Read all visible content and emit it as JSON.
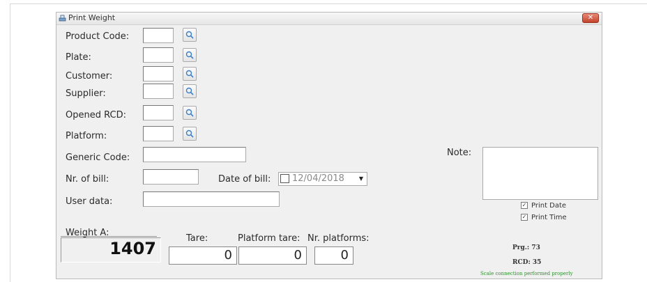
{
  "window": {
    "title": "Print Weight",
    "close_label": "✕"
  },
  "fields": {
    "product_code": {
      "label": "Product Code:",
      "value": ""
    },
    "plate": {
      "label": "Plate:",
      "value": ""
    },
    "customer": {
      "label": "Customer:",
      "value": ""
    },
    "supplier": {
      "label": "Supplier:",
      "value": ""
    },
    "opened_rcd": {
      "label": "Opened RCD:",
      "value": ""
    },
    "platform": {
      "label": "Platform:",
      "value": ""
    },
    "generic_code": {
      "label": "Generic Code:",
      "value": ""
    },
    "nr_of_bill": {
      "label": "Nr. of bill:",
      "value": ""
    },
    "date_of_bill": {
      "label": "Date of bill:",
      "value": "12/04/2018",
      "checked": false
    },
    "user_data": {
      "label": "User data:",
      "value": ""
    },
    "note": {
      "label": "Note:",
      "value": ""
    }
  },
  "options": {
    "print_date": {
      "label": "Print Date",
      "checked": true
    },
    "print_time": {
      "label": "Print Time",
      "checked": true
    }
  },
  "weight": {
    "label": "Weight A:",
    "value": "1407",
    "tare_label": "Tare:",
    "tare_value": "0",
    "platform_tare_label": "Platform tare:",
    "platform_tare_value": "0",
    "nr_platforms_label": "Nr. platforms:",
    "nr_platforms_value": "0"
  },
  "info": {
    "prg": "Prg.: 73",
    "rcd": "RCD: 35",
    "status": "Scale connection performed properly"
  },
  "icons": {
    "search": "search-icon",
    "window": "scale-icon",
    "dropdown": "dropdown-arrow-icon"
  }
}
